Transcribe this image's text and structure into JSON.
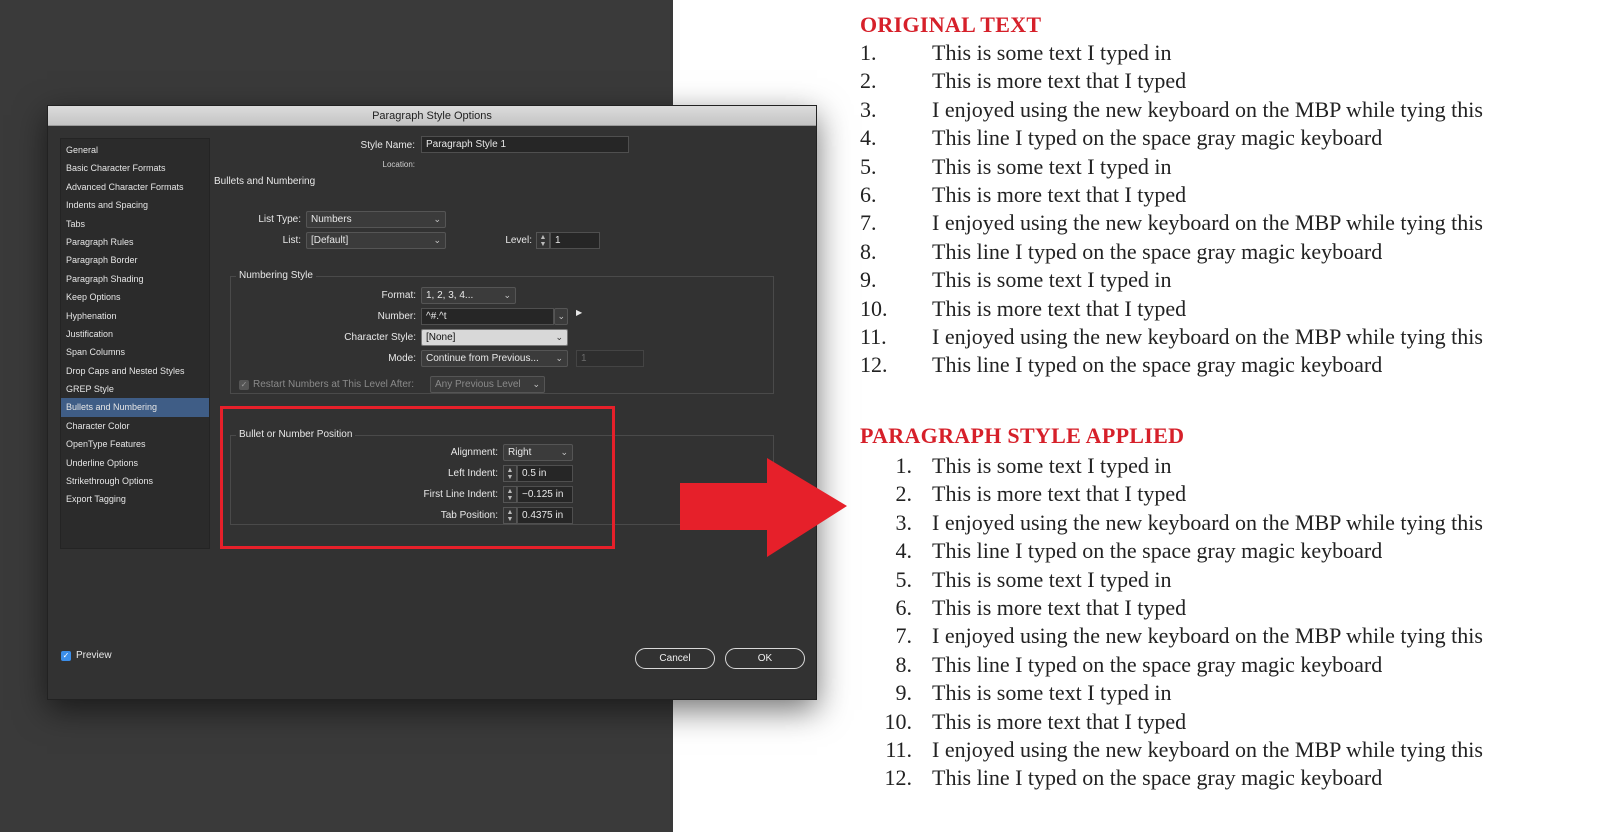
{
  "dialog": {
    "title": "Paragraph Style Options",
    "sidebar_items": [
      "General",
      "Basic Character Formats",
      "Advanced Character Formats",
      "Indents and Spacing",
      "Tabs",
      "Paragraph Rules",
      "Paragraph Border",
      "Paragraph Shading",
      "Keep Options",
      "Hyphenation",
      "Justification",
      "Span Columns",
      "Drop Caps and Nested Styles",
      "GREP Style",
      "Bullets and Numbering",
      "Character Color",
      "OpenType Features",
      "Underline Options",
      "Strikethrough Options",
      "Export Tagging"
    ],
    "selected_item": "Bullets and Numbering",
    "style_name_label": "Style Name:",
    "style_name_value": "Paragraph Style 1",
    "location_label": "Location:",
    "section_title": "Bullets and Numbering",
    "list_type_label": "List Type:",
    "list_type_value": "Numbers",
    "list_label": "List:",
    "list_value": "[Default]",
    "level_label": "Level:",
    "level_value": "1",
    "numbering_style_title": "Numbering Style",
    "format_label": "Format:",
    "format_value": "1, 2, 3, 4...",
    "number_label": "Number:",
    "number_value": "^#.^t",
    "char_style_label": "Character Style:",
    "char_style_value": "[None]",
    "mode_label": "Mode:",
    "mode_value": "Continue from Previous...",
    "mode_number": "1",
    "restart_label": "Restart Numbers at This Level After:",
    "restart_value": "Any Previous Level",
    "position_title": "Bullet or Number Position",
    "alignment_label": "Alignment:",
    "alignment_value": "Right",
    "left_indent_label": "Left Indent:",
    "left_indent_value": "0.5 in",
    "first_line_label": "First Line Indent:",
    "first_line_value": "−0.125 in",
    "tab_position_label": "Tab Position:",
    "tab_position_value": "0.4375 in",
    "preview_label": "Preview",
    "preview_checked": true,
    "cancel_label": "Cancel",
    "ok_label": "OK"
  },
  "accent_color": "#e6202a",
  "original": {
    "heading": "ORIGINAL TEXT",
    "numbers": [
      "1.",
      "2.",
      "3.",
      "4.",
      "5.",
      "6.",
      "7.",
      "8.",
      "9.",
      "10.",
      "11.",
      "12."
    ],
    "lines": [
      "This is some text I typed in",
      "This is more text that I typed",
      "I enjoyed using the new keyboard on the MBP while tying this",
      "This line I typed on the space gray magic keyboard",
      "This is some text I typed in",
      "This is more text that I typed",
      "I enjoyed using the new keyboard on the MBP while tying this",
      "This line I typed on the space gray magic keyboard",
      "This is some text I typed in",
      "This is more text that I typed",
      "I enjoyed using the new keyboard on the MBP while tying this",
      "This line I typed on the space gray magic keyboard"
    ]
  },
  "applied": {
    "heading": "PARAGRAPH STYLE APPLIED",
    "numbers": [
      "1.",
      "2.",
      "3.",
      "4.",
      "5.",
      "6.",
      "7.",
      "8.",
      "9.",
      "10.",
      "11.",
      "12."
    ],
    "lines": [
      "This is some text I typed in",
      "This is more text that I typed",
      "I enjoyed using the new keyboard on the MBP while tying this",
      "This line I typed on the space gray magic keyboard",
      "This is some text I typed in",
      "This is more text that I typed",
      "I enjoyed using the new keyboard on the MBP while tying this",
      "This line I typed on the space gray magic keyboard",
      "This is some text I typed in",
      "This is more text that I typed",
      "I enjoyed using the new keyboard on the MBP while tying this",
      "This line I typed on the space gray magic keyboard"
    ]
  }
}
